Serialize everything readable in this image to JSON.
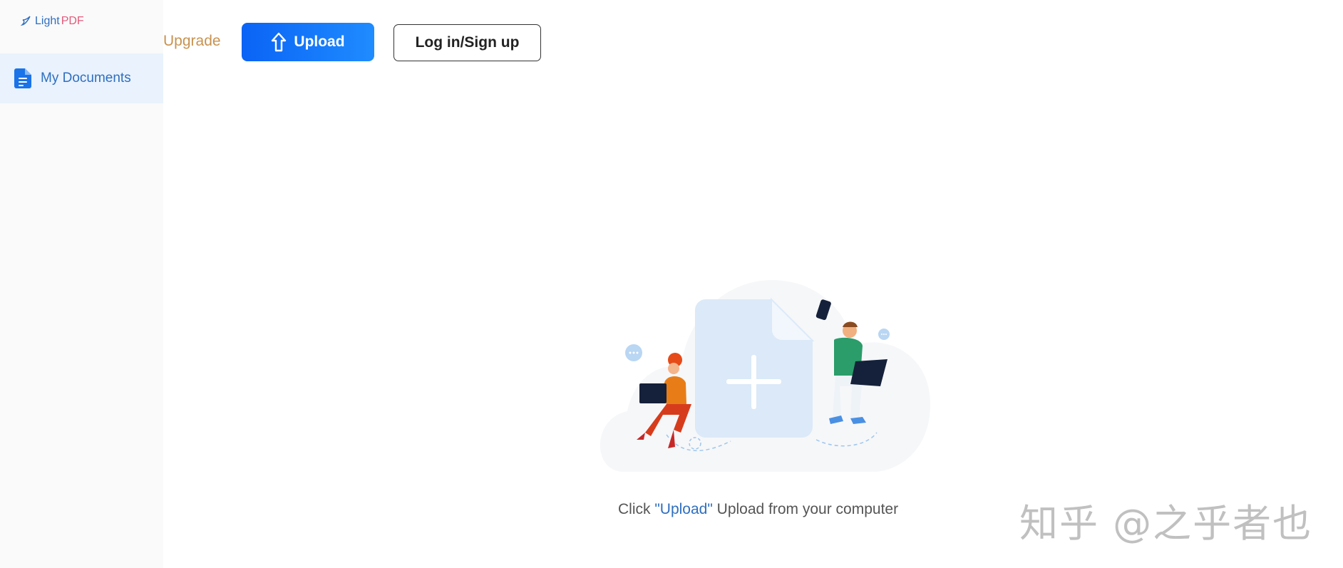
{
  "sidebar": {
    "logo_light": "Light",
    "logo_pdf": "PDF",
    "items": [
      {
        "label": "My Documents",
        "icon": "document-icon",
        "active": true
      }
    ]
  },
  "header": {
    "upgrade_label": "Upgrade",
    "upload_label": "Upload",
    "login_label": "Log in/Sign up"
  },
  "empty_state": {
    "hint_prefix": "Click ",
    "hint_keyword": "\"Upload\"",
    "hint_suffix": " Upload from your computer"
  },
  "watermark": "知乎 @之乎者也",
  "colors": {
    "accent": "#0a63f5",
    "sidebar_active_bg": "#e9f2fd",
    "link_blue": "#2f6fbf",
    "upgrade": "#c8924f"
  }
}
